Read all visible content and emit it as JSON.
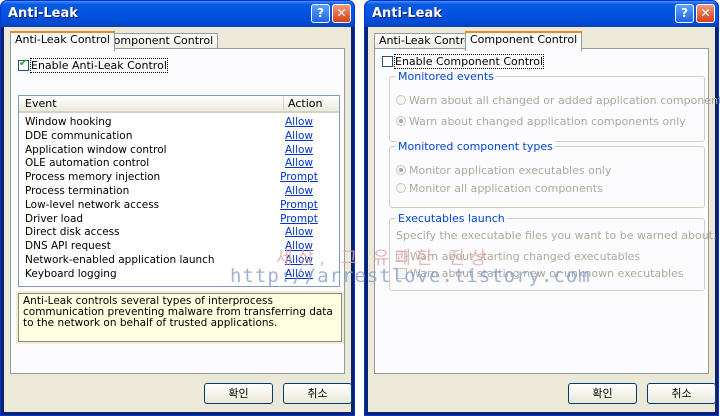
{
  "left": {
    "title": "Anti-Leak",
    "help_glyph": "?",
    "close_glyph": "✕",
    "tabs": [
      "Anti-Leak Control",
      "Component Control"
    ],
    "enable_label": "Enable Anti-Leak Control",
    "enable_checked": true,
    "grid": {
      "col_event": "Event",
      "col_action": "Action",
      "rows": [
        {
          "event": "Window hooking",
          "action": "Allow"
        },
        {
          "event": "DDE communication",
          "action": "Allow"
        },
        {
          "event": "Application window control",
          "action": "Allow"
        },
        {
          "event": "OLE automation control",
          "action": "Allow"
        },
        {
          "event": "Process memory injection",
          "action": "Prompt"
        },
        {
          "event": "Process termination",
          "action": "Allow"
        },
        {
          "event": "Low-level network access",
          "action": "Prompt"
        },
        {
          "event": "Driver load",
          "action": "Prompt"
        },
        {
          "event": "Direct disk access",
          "action": "Allow"
        },
        {
          "event": "DNS API request",
          "action": "Allow"
        },
        {
          "event": "Network-enabled application launch",
          "action": "Allow"
        },
        {
          "event": "Keyboard logging",
          "action": "Allow"
        }
      ]
    },
    "description": "Anti-Leak controls several types of interprocess communication preventing malware from transferring data to the network on behalf of trusted applications.",
    "ok_label": "확인",
    "cancel_label": "취소"
  },
  "right": {
    "title": "Anti-Leak",
    "help_glyph": "?",
    "close_glyph": "✕",
    "tabs": [
      "Anti-Leak Control",
      "Component Control"
    ],
    "enable_label": "Enable Component Control",
    "enable_checked": false,
    "monitored_events": {
      "label": "Monitored events",
      "options": [
        "Warn about all changed or added application components",
        "Warn about changed application components only"
      ],
      "selected": 1
    },
    "monitored_types": {
      "label": "Monitored component types",
      "options": [
        "Monitor application executables only",
        "Monitor all application components"
      ],
      "selected": 0
    },
    "exec_launch": {
      "label": "Executables launch",
      "hint": "Specify the executable files you want to be warned about.",
      "checks": [
        "Warn about starting changed executables",
        "Warn about starting new or unknown executables"
      ]
    },
    "ok_label": "확인",
    "cancel_label": "취소"
  },
  "watermark": {
    "line1": "세상, 그 유쾌한 진상",
    "line2": "http://arrestlove.tistory.com"
  },
  "colors": {
    "titlebar": "#0054e3",
    "link": "#0033cc",
    "group_label": "#0046d5",
    "tooltip_bg": "#ffffe1",
    "tab_accent": "#e68b2c"
  }
}
